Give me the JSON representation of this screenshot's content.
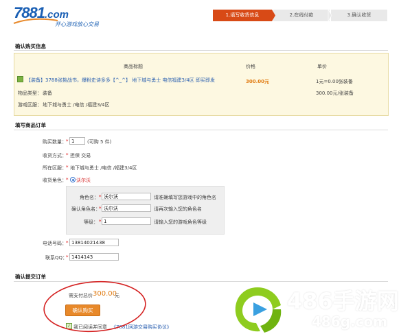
{
  "header": {
    "logo_number": "7881",
    "logo_com": ".com",
    "slogan": "开心游戏放心交易",
    "steps": [
      "1.填写收货信息",
      "2.在线付款",
      "3.确认收货"
    ]
  },
  "purchase_info": {
    "section_title": "确认购买信息",
    "col_title": "商品标题",
    "col_price": "价格",
    "col_unit": "单价",
    "item_tag": "【装备】",
    "item_title": "3788张挑战书，爆粉史诗多多【^_^】 地下城与勇士 电信福建3/4区 即买即发",
    "price": "300.00元",
    "unit_price_1": "1元=0.00张装备",
    "unit_price_2": "300.00元/张装备",
    "type_label": "物品类型：",
    "type_value": "装备",
    "zone_label": "游戏区服：",
    "zone_value": "地下城与勇士 /电信 /福建3/4区"
  },
  "order_form": {
    "section_title": "填写商品订单",
    "qty_label": "购买数量：",
    "qty_value": "1",
    "qty_hint": "(可购 5 件)",
    "method_label": "收货方式：",
    "method_value": "担保 交易",
    "zone_label": "所在区服：",
    "zone_value": "地下城与勇士 /电信 /福建3/4区",
    "role_label": "收货角色：",
    "role_option": "沃尔沃",
    "role_name_label": "角色名：",
    "role_name_value": "沃尔沃",
    "role_name_hint": "请准确填写您游戏中的角色名",
    "confirm_role_label": "确认角色名：",
    "confirm_role_value": "沃尔沃",
    "confirm_role_hint": "请再次输入您的角色名",
    "level_label": "等级：",
    "level_value": "1",
    "level_hint": "请输入您的游戏角色等级",
    "phone_label": "电话号码：",
    "phone_value": "13814021438",
    "qq_label": "联系QQ：",
    "qq_value": "1414143",
    "required_mark": "*"
  },
  "submit": {
    "section_title": "确认提交订单",
    "total_label": "需支付总价",
    "total_value": "300.00",
    "total_unit": "元",
    "button_label": "确认购买",
    "agree_text": "我已阅读并同意",
    "agree_link": "《7881网游交易购买协议》"
  },
  "watermark": {
    "brand": "486手游网",
    "domain": "486g.com"
  },
  "colors": {
    "accent": "#d84a16",
    "price": "#e07a10",
    "link": "#2a5fb0",
    "annotation": "#d42020"
  }
}
